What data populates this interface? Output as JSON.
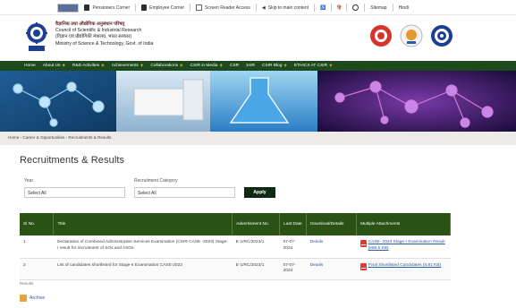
{
  "topbar": {
    "items": [
      {
        "label": "Pensioners Corner",
        "icon": "user-icon"
      },
      {
        "label": "Employee Corner",
        "icon": "user-icon"
      },
      {
        "label": "Screen Reader Access",
        "icon": "screen-reader-icon"
      },
      {
        "label": "Skip to main content",
        "icon": "arrow-left-icon"
      },
      {
        "label": "",
        "icon": "accessibility-icon"
      },
      {
        "label": "हिं",
        "icon": "language-icon"
      },
      {
        "label": "",
        "icon": "search-icon"
      },
      {
        "label": "Sitemap",
        "icon": ""
      },
      {
        "label": "Hindi",
        "icon": ""
      }
    ]
  },
  "header": {
    "org_hindi": "वैज्ञानिक तथा औद्योगिक अनुसंधान परिषद्",
    "org_english": "Council of Scientific & Industrial Research",
    "ministry_hindi": "(विज्ञान एवं प्रौद्योगिकी मंत्रालय, भारत सरकार)",
    "ministry_english": "Ministry of Science & Technology, Govt. of India"
  },
  "nav": {
    "items": [
      {
        "label": "Home",
        "has_plus": false
      },
      {
        "label": "About Us",
        "has_plus": true
      },
      {
        "label": "R&D Activities",
        "has_plus": true
      },
      {
        "label": "Achievements",
        "has_plus": true
      },
      {
        "label": "Collaborations",
        "has_plus": true
      },
      {
        "label": "CSIR in Media",
        "has_plus": true
      },
      {
        "label": "CSR",
        "has_plus": false
      },
      {
        "label": "SSR",
        "has_plus": false
      },
      {
        "label": "CSIR Blog",
        "has_plus": true
      },
      {
        "label": "ETHICS AT CSIR",
        "has_plus": true
      }
    ],
    "plus": "+"
  },
  "breadcrumb": {
    "text": "Home › Career & Opportunities › Recruitments & Results"
  },
  "page": {
    "title": "Recruitments & Results"
  },
  "filters": {
    "year_label": "Year",
    "year_value": "Select All",
    "category_label": "Recruitment Category",
    "category_value": "Select All",
    "apply_label": "Apply"
  },
  "table": {
    "headers": [
      "Sl No.",
      "Title",
      "Advertisment No.",
      "Last Date",
      "Download/Details",
      "Multiple Attachments"
    ],
    "rows": [
      {
        "sl": "1",
        "title": "Declaration of Combined Administrative Services Examination (CSIR CASE -2023) Stage-I result for recruitment of SOs and ASOs.",
        "adv": "E-1/RC/2023/1",
        "last_date": "07-07-2024",
        "details": "Details",
        "attachment": "CASE- 2023 Stage-I Examination Result (698.5 KB)"
      },
      {
        "sl": "2",
        "title": "List of candidates shortlisted for Stage-II Examination CASE-2023",
        "adv": "E-1/RC/2023/1",
        "last_date": "07-07-2024",
        "details": "Details",
        "attachment": "Final Shortlisted Candidates (5.81 KB)"
      }
    ]
  },
  "results_label": "Results",
  "archive_label": "Archive"
}
